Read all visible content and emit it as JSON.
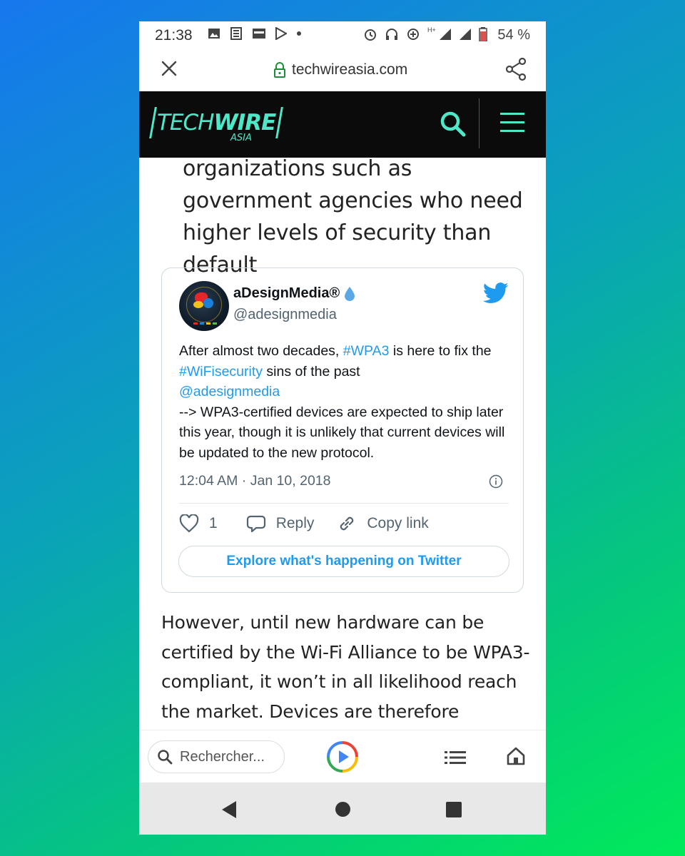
{
  "status_bar": {
    "time": "21:38",
    "battery_percent": "54 %",
    "network": "H+",
    "left_icons": [
      "image-icon",
      "news-icon",
      "card-icon",
      "play-store-icon",
      "dot-icon"
    ],
    "right_icons": [
      "alarm-icon",
      "headset-icon",
      "data-saver-icon",
      "signal-icon",
      "signal-icon",
      "battery-icon"
    ]
  },
  "url_bar": {
    "domain": "techwireasia.com",
    "icons": [
      "close-icon",
      "lock-icon",
      "share-icon"
    ]
  },
  "site_header": {
    "logo_text_light": "TECH",
    "logo_text_bold": "WIRE",
    "logo_sub": "ASIA",
    "accent_color": "#4ee8c9",
    "background": "#0b0b0b"
  },
  "article": {
    "top_text": "organizations such as government agencies who need higher levels of security than default",
    "bottom_text": "However, until new hardware can be certified by the Wi-Fi Alliance to be WPA3-compliant, it won’t in all likelihood reach the market. Devices are therefore expected"
  },
  "tweet": {
    "name": "aDesignMedia®",
    "handle": "@adesignmedia",
    "text_1": "After almost two decades, ",
    "tag_1": "#WPA3",
    "text_2": " is here to fix the ",
    "tag_2": "#WiFisecurity",
    "text_3": " sins of the past ",
    "mention": "@adesignmedia",
    "text_4": "--> WPA3-certified devices are expected to ship later this year, though it is unlikely that current devices will be updated to the new protocol.",
    "timestamp": "12:04 AM · Jan 10, 2018",
    "like_count": "1",
    "reply_label": "Reply",
    "copy_link_label": "Copy link",
    "explore_label": "Explore what's happening on Twitter",
    "link_color": "#1d9bf0"
  },
  "app_bar": {
    "search_placeholder": "Rechercher..."
  }
}
